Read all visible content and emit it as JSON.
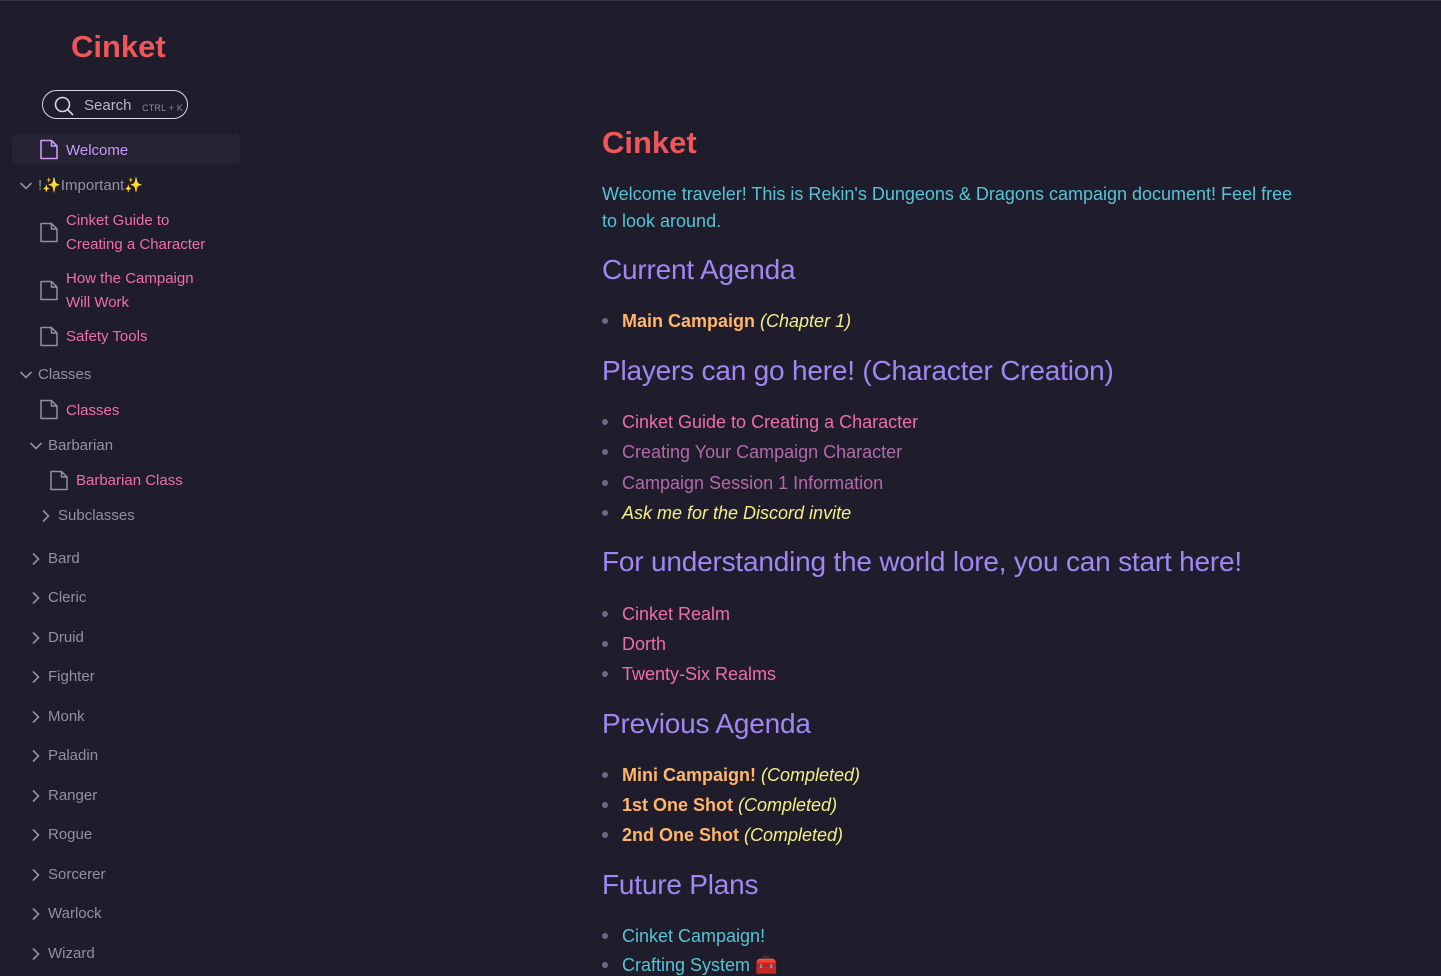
{
  "app": {
    "brand": "Cinket"
  },
  "search": {
    "placeholder": "Search",
    "shortcut": "CTRL + K"
  },
  "sidebar": {
    "welcome": "Welcome",
    "important_group": "!✨Important✨",
    "important_items": [
      {
        "line1": "Cinket Guide to",
        "line2": "Creating a Character"
      },
      {
        "line1": "How the Campaign",
        "line2": "Will Work"
      },
      {
        "line1": "Safety Tools"
      }
    ],
    "classes_group": "Classes",
    "classes_doc": "Classes",
    "barbarian_group": "Barbarian",
    "barbarian_doc": "Barbarian Class",
    "subclasses_group": "Subclasses",
    "class_folders": [
      "Bard",
      "Cleric",
      "Druid",
      "Fighter",
      "Monk",
      "Paladin",
      "Ranger",
      "Rogue",
      "Sorcerer",
      "Warlock",
      "Wizard"
    ]
  },
  "main": {
    "title": "Cinket",
    "intro": "Welcome traveler! This is Rekin's Dungeons & Dragons campaign document! Feel free to look around.",
    "sections": [
      {
        "heading": "Current Agenda",
        "items": [
          {
            "bold": "Main Campaign",
            "note": "(Chapter 1)"
          }
        ]
      },
      {
        "heading": "Players can go here! (Character Creation)",
        "items": [
          {
            "text": "Cinket Guide to Creating a Character",
            "style": "pink"
          },
          {
            "text": "Creating Your Campaign Character",
            "style": "mauve"
          },
          {
            "text": "Campaign Session 1 Information",
            "style": "mauve"
          },
          {
            "text": "Ask me for the Discord invite",
            "style": "yellow"
          }
        ]
      },
      {
        "heading": "For understanding the world lore, you can start here!",
        "items": [
          {
            "text": "Cinket Realm"
          },
          {
            "text": "Dorth"
          },
          {
            "text": "Twenty-Six Realms"
          }
        ]
      },
      {
        "heading": "Previous Agenda",
        "items": [
          {
            "bold": "Mini Campaign!",
            "note": "(Completed)"
          },
          {
            "bold": "1st One Shot",
            "note": "(Completed)"
          },
          {
            "bold": "2nd One Shot",
            "note": "(Completed)"
          }
        ]
      },
      {
        "heading": "Future Plans",
        "items": [
          {
            "text": "Cinket Campaign!"
          },
          {
            "text": "Crafting System",
            "emoji": "🧰"
          }
        ]
      }
    ]
  },
  "colors": {
    "background": "#1f1d2b",
    "brand_red": "#f0555a",
    "heading_purple": "#a087f2",
    "link_pink": "#ee6fa6",
    "intro_cyan": "#56c3d6",
    "accent_orange": "#ffb66b",
    "note_yellow": "#f3ef86"
  }
}
